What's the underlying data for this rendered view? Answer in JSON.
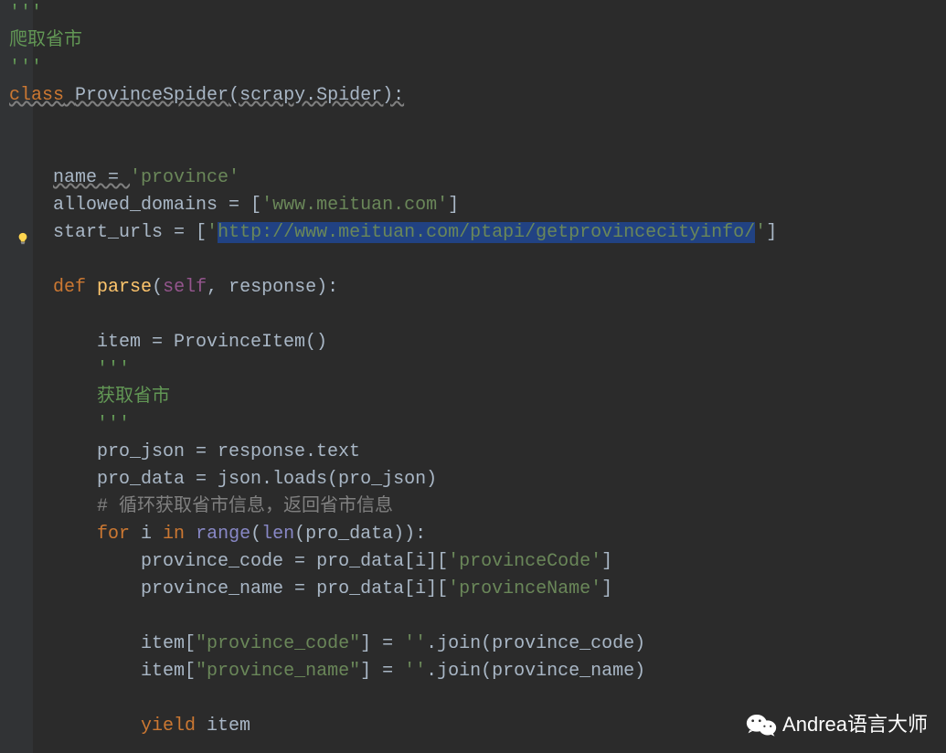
{
  "code": {
    "docTop": "爬取省市",
    "triple": "'''",
    "kwClass": "class",
    "className": "ProvinceSpider",
    "classBase": "(scrapy.Spider):",
    "nameLabel": "name = ",
    "nameVal": "'province'",
    "domainsLabel": "allowed_domains = [",
    "domainsVal": "'www.meituan.com'",
    "domainsEnd": "]",
    "urlsLabel": "start_urls = [",
    "urlsQ": "'",
    "urlsVal": "http://www.meituan.com/ptapi/getprovincecityinfo/",
    "urlsEnd": "]",
    "kwDef": "def",
    "defName": "parse",
    "defParen": "(",
    "selfWord": "self",
    "defRest": ", response):",
    "itemLine": "item = ProvinceItem()",
    "docMid": "获取省市",
    "proJson": "pro_json = response.text",
    "proData1": "pro_data = json.loads(pro_json)",
    "comment": "# 循环获取省市信息，返回省市信息",
    "kwFor": "for",
    "forI": " i ",
    "kwIn": "in",
    "forSpace": " ",
    "rangeFn": "range",
    "lenFn": "len",
    "forRest": "(pro_data)):",
    "pcLine1a": "province_code = pro_data[i][",
    "pcStr1": "'provinceCode'",
    "pcLine1b": "]",
    "pnLine1a": "province_name = pro_data[i][",
    "pnStr1": "'provinceName'",
    "pnLine1b": "]",
    "itm1a": "item[",
    "itm1s": "\"province_code\"",
    "itm1b": "] = ",
    "emptyStr": "''",
    "joinRest1": ".join(province_code)",
    "itm2s": "\"province_name\"",
    "joinRest2": ".join(province_name)",
    "kwYield": "yield",
    "yieldRest": " item"
  },
  "watermark": {
    "text": "Andrea语言大师"
  }
}
